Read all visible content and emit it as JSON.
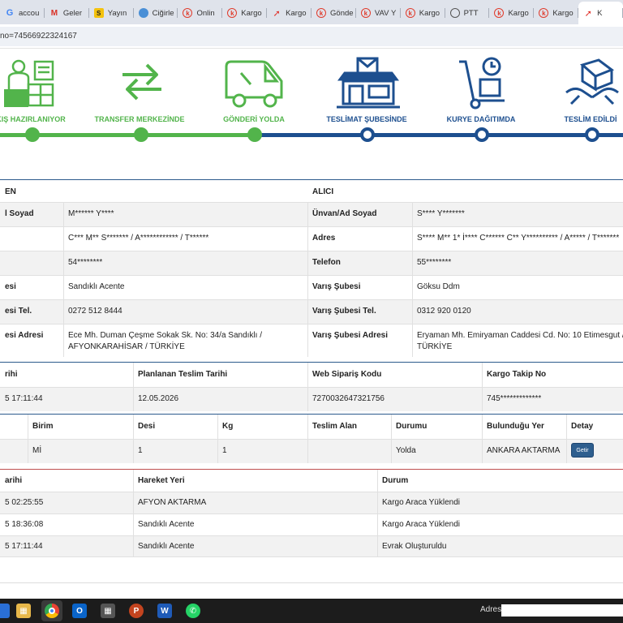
{
  "browser": {
    "tabs": [
      {
        "favicon": "g",
        "label": "accou"
      },
      {
        "favicon": "m",
        "label": "Geler"
      },
      {
        "favicon": "s",
        "label": "Yayın"
      },
      {
        "favicon": "ci",
        "label": "Ciğirle"
      },
      {
        "favicon": "kargo",
        "label": "Onlin"
      },
      {
        "favicon": "kargo",
        "label": "Kargo"
      },
      {
        "favicon": "vav",
        "label": "Kargo"
      },
      {
        "favicon": "kargo",
        "label": "Gönde"
      },
      {
        "favicon": "kargo",
        "label": "VAV Y"
      },
      {
        "favicon": "kargo",
        "label": "Kargo"
      },
      {
        "favicon": "globe",
        "label": "PTT"
      },
      {
        "favicon": "kargo",
        "label": "Kargo"
      },
      {
        "favicon": "kargo",
        "label": "Kargo"
      },
      {
        "favicon": "vav",
        "label": "K"
      }
    ],
    "url": "no=74566922324167"
  },
  "steps": [
    {
      "label": "KIŞ HAZIRLANIYOR",
      "status": "done"
    },
    {
      "label": "TRANSFER MERKEZİNDE",
      "status": "done"
    },
    {
      "label": "GÖNDERİ YOLDA",
      "status": "done"
    },
    {
      "label": "TESLİMAT ŞUBESİNDE",
      "status": "pending"
    },
    {
      "label": "KURYE DAĞITIMDA",
      "status": "pending"
    },
    {
      "label": "TESLİM EDİLDİ",
      "status": "pending"
    }
  ],
  "parties": {
    "sender_header": "EN",
    "receiver_header": "ALICI",
    "rows": [
      {
        "s_label": "l Soyad",
        "s_value": "M****** Y****",
        "r_label": "Ünvan/Ad Soyad",
        "r_value": "S**** Y*******"
      },
      {
        "s_label": "",
        "s_value": "C*** M** S******* / A************ / T******",
        "r_label": "Adres",
        "r_value": "S**** M** 1* İ**** C****** C** Y********** / A***** / T*******"
      },
      {
        "s_label": "",
        "s_value": "54********",
        "r_label": "Telefon",
        "r_value": "55********"
      },
      {
        "s_label": "esi",
        "s_value": "Sandıklı Acente",
        "r_label": "Varış Şubesi",
        "r_value": "Göksu Ddm"
      },
      {
        "s_label": "esi Tel.",
        "s_value": "0272 512 8444",
        "r_label": "Varış Şubesi Tel.",
        "r_value": "0312 920 0120"
      },
      {
        "s_label": "esi Adresi",
        "s_value": "Ece Mh. Duman Çeşme Sokak Sk. No: 34/a Sandıklı / AFYONKARAHİSAR / TÜRKİYE",
        "r_label": "Varış Şubesi Adresi",
        "r_value": "Eryaman Mh. Emiryaman Caddesi Cd. No: 10 Etimesgut / A / TÜRKİYE"
      }
    ]
  },
  "shipment": {
    "headers": [
      "rihi",
      "Planlanan Teslim Tarihi",
      "Web Sipariş Kodu",
      "Kargo Takip No"
    ],
    "values": [
      "5 17:11:44",
      "12.05.2026",
      "7270032647321756",
      "745*************"
    ]
  },
  "package": {
    "headers": [
      "Birim",
      "Desi",
      "Kg",
      "Teslim Alan",
      "Durumu",
      "Bulunduğu Yer",
      "Detay"
    ],
    "values": [
      "",
      "Mİ",
      "1",
      "1",
      "",
      "Yolda",
      "ANKARA AKTARMA"
    ],
    "button_label": "Getir"
  },
  "movements": {
    "headers": [
      "arihi",
      "Hareket Yeri",
      "Durum"
    ],
    "rows": [
      [
        "5 02:25:55",
        "AFYON AKTARMA",
        "Kargo Araca Yüklendi"
      ],
      [
        "5 18:36:08",
        "Sandıklı Acente",
        "Kargo Araca Yüklendi"
      ],
      [
        "5 17:11:44",
        "Sandıklı Acente",
        "Evrak Oluşturuldu"
      ]
    ]
  },
  "taskbar": {
    "address_label": "Adres"
  },
  "colors": {
    "done": "#52b44b",
    "pending": "#1d4f8f"
  }
}
